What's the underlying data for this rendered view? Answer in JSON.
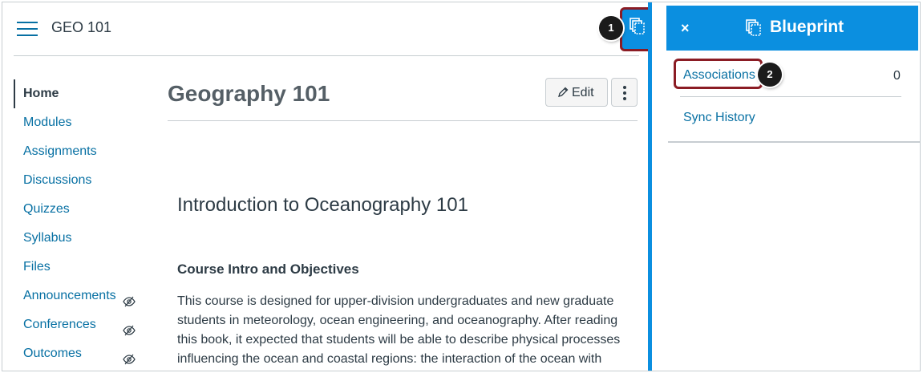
{
  "course": {
    "code": "GEO 101",
    "page_title": "Geography 101",
    "edit_label": "Edit"
  },
  "nav": {
    "items": [
      {
        "label": "Home",
        "active": true,
        "hidden": false
      },
      {
        "label": "Modules",
        "active": false,
        "hidden": false
      },
      {
        "label": "Assignments",
        "active": false,
        "hidden": false
      },
      {
        "label": "Discussions",
        "active": false,
        "hidden": false
      },
      {
        "label": "Quizzes",
        "active": false,
        "hidden": false
      },
      {
        "label": "Syllabus",
        "active": false,
        "hidden": false
      },
      {
        "label": "Files",
        "active": false,
        "hidden": false
      },
      {
        "label": "Announcements",
        "active": false,
        "hidden": true
      },
      {
        "label": "Conferences",
        "active": false,
        "hidden": true
      },
      {
        "label": "Outcomes",
        "active": false,
        "hidden": true
      }
    ]
  },
  "content": {
    "heading": "Introduction to Oceanography 101",
    "subheading": "Course Intro and Objectives",
    "paragraph": "This course is designed for upper-division undergraduates and new graduate students in meteorology, ocean engineering, and oceanography. After reading this book, it expected that students will be able to describe physical processes influencing the ocean and coastal regions: the interaction of the ocean with the"
  },
  "tray": {
    "close_symbol": "×",
    "title": "Blueprint",
    "associations_label": "Associations",
    "associations_count": "0",
    "sync_history_label": "Sync History"
  },
  "callouts": {
    "one": "1",
    "two": "2"
  },
  "icons": {
    "menu": "hamburger-menu-icon",
    "blueprint": "blueprint-icon",
    "hidden": "eye-slash-icon",
    "edit": "pencil-icon",
    "more": "kebab-icon",
    "close": "close-icon"
  },
  "colors": {
    "accent": "#0b8fe0",
    "link": "#0770a3",
    "text": "#2d3b45",
    "highlight": "#8b1c24"
  }
}
